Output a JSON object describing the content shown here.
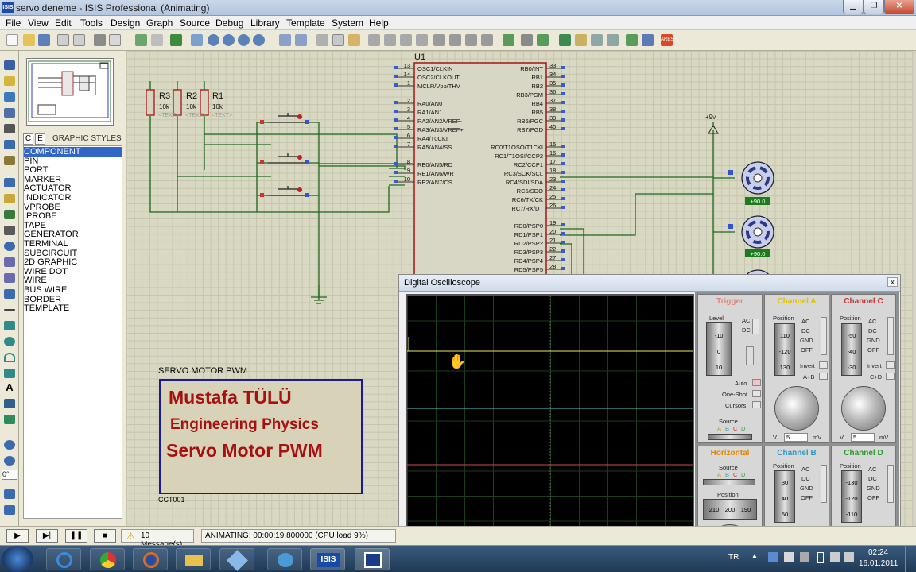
{
  "window": {
    "title": "servo deneme - ISIS Professional (Animating)",
    "app_icon": "ISIS"
  },
  "menu": [
    "File",
    "View",
    "Edit",
    "Tools",
    "Design",
    "Graph",
    "Source",
    "Debug",
    "Library",
    "Template",
    "System",
    "Help"
  ],
  "selector": {
    "tab_c": "C",
    "tab_e": "E",
    "panel_label": "GRAPHIC STYLES",
    "items": [
      "COMPONENT",
      "PIN",
      "PORT",
      "MARKER",
      "ACTUATOR",
      "INDICATOR",
      "VPROBE",
      "IPROBE",
      "TAPE",
      "GENERATOR",
      "TERMINAL",
      "SUBCIRCUIT",
      "2D GRAPHIC",
      "WIRE DOT",
      "WIRE",
      "BUS WIRE",
      "BORDER",
      "TEMPLATE"
    ],
    "selected": "COMPONENT"
  },
  "rotation": "0°",
  "schematic": {
    "mcu_ref": "U1",
    "left_pins": [
      {
        "num": "13",
        "name": "OSC1/CLKIN"
      },
      {
        "num": "14",
        "name": "OSC2/CLKOUT"
      },
      {
        "num": "1",
        "name": "MCLR/Vpp/THV"
      },
      {
        "num": "2",
        "name": "RA0/AN0"
      },
      {
        "num": "3",
        "name": "RA1/AN1"
      },
      {
        "num": "4",
        "name": "RA2/AN2/VREF-"
      },
      {
        "num": "5",
        "name": "RA3/AN3/VREF+"
      },
      {
        "num": "6",
        "name": "RA4/T0CKI"
      },
      {
        "num": "7",
        "name": "RA5/AN4/SS"
      },
      {
        "num": "8",
        "name": "RE0/AN5/RD"
      },
      {
        "num": "9",
        "name": "RE1/AN6/WR"
      },
      {
        "num": "10",
        "name": "RE2/AN7/CS"
      }
    ],
    "right_pins": [
      {
        "num": "33",
        "name": "RB0/INT"
      },
      {
        "num": "34",
        "name": "RB1"
      },
      {
        "num": "35",
        "name": "RB2"
      },
      {
        "num": "36",
        "name": "RB3/PGM"
      },
      {
        "num": "37",
        "name": "RB4"
      },
      {
        "num": "38",
        "name": "RB5"
      },
      {
        "num": "39",
        "name": "RB6/PGC"
      },
      {
        "num": "40",
        "name": "RB7/PGD"
      },
      {
        "num": "15",
        "name": "RC0/T1OSO/T1CKI"
      },
      {
        "num": "16",
        "name": "RC1/T1OSI/CCP2"
      },
      {
        "num": "17",
        "name": "RC2/CCP1"
      },
      {
        "num": "18",
        "name": "RC3/SCK/SCL"
      },
      {
        "num": "23",
        "name": "RC4/SDI/SDA"
      },
      {
        "num": "24",
        "name": "RC5/SDO"
      },
      {
        "num": "25",
        "name": "RC6/TX/CK"
      },
      {
        "num": "26",
        "name": "RC7/RX/DT"
      },
      {
        "num": "19",
        "name": "RD0/PSP0"
      },
      {
        "num": "20",
        "name": "RD1/PSP1"
      },
      {
        "num": "21",
        "name": "RD2/PSP2"
      },
      {
        "num": "22",
        "name": "RD3/PSP3"
      },
      {
        "num": "27",
        "name": "RD4/PSP4"
      },
      {
        "num": "28",
        "name": "RD5/PSP5"
      }
    ],
    "resistors": [
      {
        "ref": "R3",
        "value": "10k"
      },
      {
        "ref": "R2",
        "value": "10k"
      },
      {
        "ref": "R1",
        "value": "10k"
      }
    ],
    "text_placeholder": "<TEXT>",
    "supply": "+9v",
    "servo_angle_1": "+90.0",
    "servo_angle_2": "+90.0",
    "frame_caption": "SERVO MOTOR PWM",
    "frame_line1": "Mustafa TÜLÜ",
    "frame_line2": "Engineering Physics",
    "frame_line3": "Servo Motor PWM",
    "frame_ref": "CCT001"
  },
  "oscilloscope": {
    "title": "Digital Oscilloscope",
    "close": "x",
    "trigger": {
      "title": "Trigger",
      "level_label": "Level",
      "level_ticks": [
        "-10",
        "0",
        "10"
      ],
      "ac": "AC",
      "dc": "DC",
      "auto": "Auto",
      "one_shot": "One-Shot",
      "cursors": "Cursors",
      "source_label": "Source",
      "source_opts": [
        "A",
        "B",
        "C",
        "D"
      ]
    },
    "channel_a": {
      "title": "Channel A",
      "position_label": "Position",
      "ticks": [
        "110",
        "-120",
        "130"
      ],
      "ac": "AC",
      "dc": "DC",
      "gnd": "GND",
      "off": "OFF",
      "invert": "Invert",
      "sum": "A+B",
      "scale_low": "V",
      "scale_value": "5",
      "scale_unit": "mV"
    },
    "channel_c": {
      "title": "Channel C",
      "position_label": "Position",
      "ticks": [
        "-50",
        "-40",
        "-30"
      ],
      "ac": "AC",
      "dc": "DC",
      "gnd": "GND",
      "off": "OFF",
      "invert": "Invert",
      "sum": "C+D",
      "scale_low": "V",
      "scale_value": "5",
      "scale_unit": "mV"
    },
    "horizontal": {
      "title": "Horizontal",
      "source_label": "Source",
      "source_opts": [
        "A",
        "B",
        "C",
        "D"
      ],
      "position_label": "Position",
      "ticks": [
        "210",
        "200",
        "190"
      ]
    },
    "channel_b": {
      "title": "Channel B",
      "position_label": "Position",
      "ticks": [
        "30",
        "40",
        "50"
      ],
      "ac": "AC",
      "dc": "DC",
      "gnd": "GND",
      "off": "OFF"
    },
    "channel_d": {
      "title": "Channel D",
      "position_label": "Position",
      "ticks": [
        "-130",
        "-120",
        "-110"
      ],
      "ac": "AC",
      "dc": "DC",
      "gnd": "GND",
      "off": "OFF"
    },
    "trace_colors": {
      "a": "#e8e86a",
      "b": "#5fc6c6",
      "c": "#d24a4a",
      "d": "#5ec85e"
    }
  },
  "status": {
    "messages": "10 Message(s)",
    "animating": "ANIMATING: 00:00:19.800000 (CPU load 9%)"
  },
  "taskbar": {
    "lang": "TR",
    "time": "02:24",
    "date": "16.01.2011",
    "isis_label": "ISIS"
  },
  "colors": {
    "titlebar": "#b3c6df",
    "canvas": "#d9d9c3",
    "frame_text": "#a51010",
    "frame_border": "#1b1b8e",
    "frame_bg": "#d8d3b8"
  }
}
